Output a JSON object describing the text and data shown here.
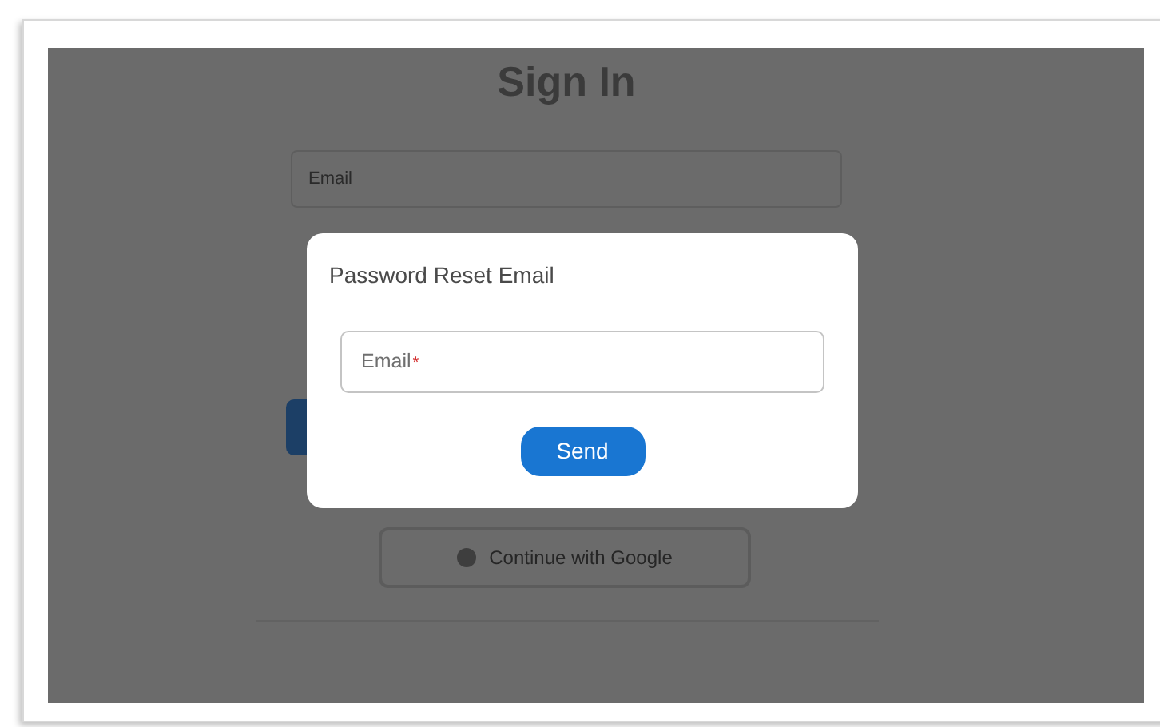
{
  "background_page": {
    "title": "Sign In",
    "email_field": {
      "placeholder": "Email"
    },
    "google_button": {
      "label": "Continue with Google"
    }
  },
  "dialog": {
    "title": "Password Reset Email",
    "email_field": {
      "label": "Email",
      "required_mark": "*"
    },
    "send_button": {
      "label": "Send"
    }
  }
}
